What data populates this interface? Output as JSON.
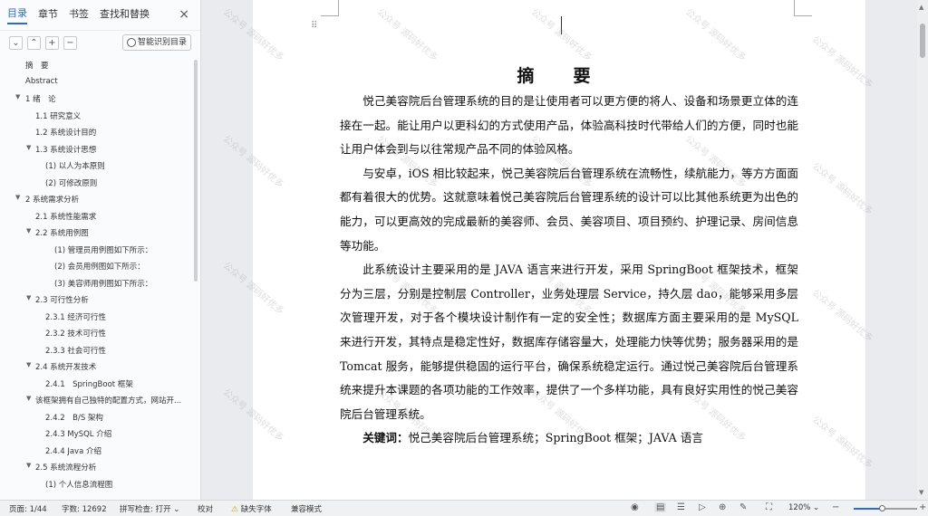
{
  "nav": {
    "tabs": [
      "目录",
      "章节",
      "书签",
      "查找和替换"
    ],
    "active_tab": "目录",
    "close_icon": "×",
    "tools": [
      "⌄",
      "⌃",
      "+",
      "−"
    ],
    "smart_button_label": "智能识别目录",
    "toc": [
      {
        "label": "摘　要",
        "level": 0,
        "caret": false
      },
      {
        "label": "Abstract",
        "level": 0,
        "caret": false
      },
      {
        "label": "1 绪　论",
        "level": 0,
        "caret": true
      },
      {
        "label": "1.1 研究意义",
        "level": 1,
        "caret": false
      },
      {
        "label": "1.2 系统设计目的",
        "level": 1,
        "caret": false
      },
      {
        "label": "1.3 系统设计思想",
        "level": 1,
        "caret": true
      },
      {
        "label": "(1) 以人为本原则",
        "level": 2,
        "caret": false
      },
      {
        "label": "(2) 可修改原则",
        "level": 2,
        "caret": false
      },
      {
        "label": "2 系统需求分析",
        "level": 0,
        "caret": true
      },
      {
        "label": "2.1 系统性能需求",
        "level": 1,
        "caret": false
      },
      {
        "label": "2.2 系统用例图",
        "level": 1,
        "caret": true
      },
      {
        "label": "(1) 管理员用例图如下所示：",
        "level": 3,
        "caret": false
      },
      {
        "label": "(2) 会员用例图如下所示：",
        "level": 3,
        "caret": false
      },
      {
        "label": "(3) 美容师用例图如下所示：",
        "level": 3,
        "caret": false
      },
      {
        "label": "2.3 可行性分析",
        "level": 1,
        "caret": true
      },
      {
        "label": "2.3.1 经济可行性",
        "level": 2,
        "caret": false
      },
      {
        "label": "2.3.2 技术可行性",
        "level": 2,
        "caret": false
      },
      {
        "label": "2.3.3 社会可行性",
        "level": 2,
        "caret": false
      },
      {
        "label": "2.4 系统开发技术",
        "level": 1,
        "caret": true
      },
      {
        "label": "2.4.1　SpringBoot 框架",
        "level": 2,
        "caret": false
      },
      {
        "label": "该框架拥有自己独特的配置方式，网站开...",
        "level": 1,
        "caret": true
      },
      {
        "label": "2.4.2　B/S 架构",
        "level": 2,
        "caret": false
      },
      {
        "label": "2.4.3 MySQL 介绍",
        "level": 2,
        "caret": false
      },
      {
        "label": "2.4.4 Java 介绍",
        "level": 2,
        "caret": false
      },
      {
        "label": "2.5 系统流程分析",
        "level": 1,
        "caret": true
      },
      {
        "label": "(1) 个人信息流程图",
        "level": 2,
        "caret": false
      }
    ]
  },
  "document": {
    "title": "摘　要",
    "paragraphs": [
      "悦己美容院后台管理系统的目的是让使用者可以更方便的将人、设备和场景更立体的连接在一起。能让用户以更科幻的方式使用产品，体验高科技时代带给人们的方便，同时也能让用户体会到与以往常规产品不同的体验风格。",
      "与安卓，iOS 相比较起来，悦己美容院后台管理系统在流畅性，续航能力，等方方面面都有着很大的优势。这就意味着悦己美容院后台管理系统的设计可以比其他系统更为出色的能力，可以更高效的完成最新的美容师、会员、美容项目、项目预约、护理记录、房间信息等功能。",
      "此系统设计主要采用的是 JAVA 语言来进行开发，采用 SpringBoot 框架技术，框架分为三层，分别是控制层 Controller，业务处理层 Service，持久层 dao，能够采用多层次管理开发，对于各个模块设计制作有一定的安全性；数据库方面主要采用的是 MySQL 来进行开发，其特点是稳定性好，数据库存储容量大，处理能力快等优势；服务器采用的是 Tomcat 服务，能够提供稳固的运行平台，确保系统稳定运行。通过悦己美容院后台管理系统来提升本课题的各项功能的工作效率，提供了一个多样功能，具有良好实用性的悦己美容院后台管理系统。"
    ],
    "keywords_label": "关键词：",
    "keywords_text": "悦己美容院后台管理系统；SpringBoot 框架；JAVA 语言",
    "watermark": "公众号 源码好优多"
  },
  "status_bar": {
    "page": "页面: 1/44",
    "words": "字数: 12692",
    "spellcheck": "拼写检查: 打开",
    "spellcheck_caret": "⌄",
    "proofread": "校对",
    "missing_font": "缺失字体",
    "compat_mode": "兼容模式",
    "zoom": "120%",
    "zoom_caret": "⌄",
    "zoom_level": 0.45
  }
}
